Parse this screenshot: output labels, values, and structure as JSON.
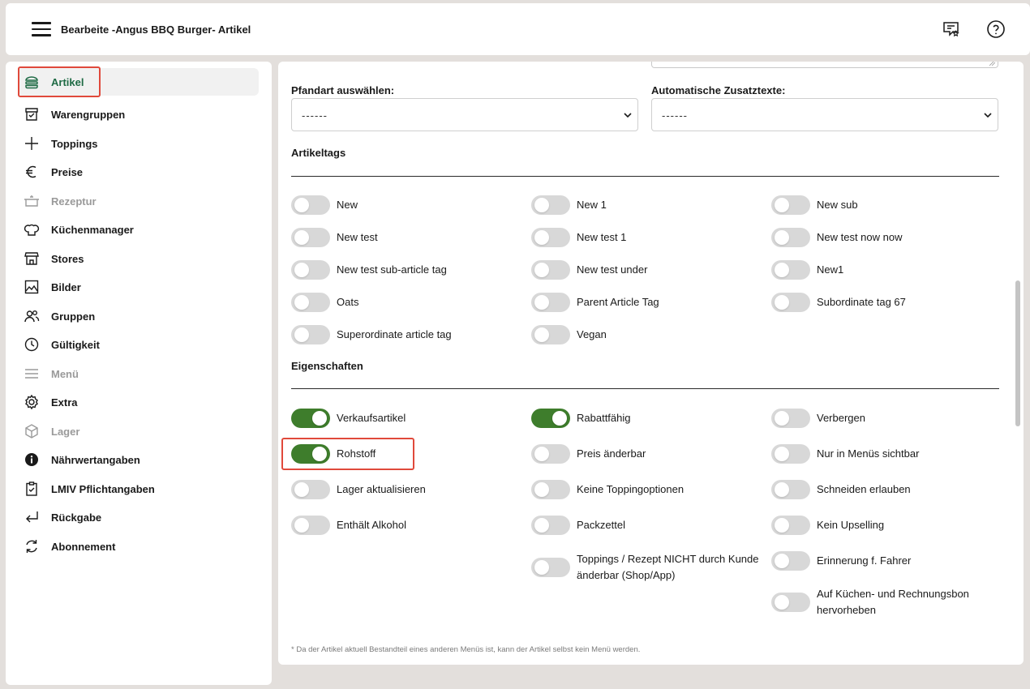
{
  "header": {
    "title": "Bearbeite -Angus BBQ Burger- Artikel"
  },
  "sidebar": {
    "items": [
      {
        "label": "Artikel",
        "icon": "burger-icon",
        "state": "active"
      },
      {
        "label": "Warengruppen",
        "icon": "category-icon",
        "state": "normal"
      },
      {
        "label": "Toppings",
        "icon": "plus-icon",
        "state": "normal"
      },
      {
        "label": "Preise",
        "icon": "euro-icon",
        "state": "normal"
      },
      {
        "label": "Rezeptur",
        "icon": "pot-icon",
        "state": "disabled"
      },
      {
        "label": "Küchenmanager",
        "icon": "chef-hat-icon",
        "state": "normal"
      },
      {
        "label": "Stores",
        "icon": "store-icon",
        "state": "normal"
      },
      {
        "label": "Bilder",
        "icon": "image-icon",
        "state": "normal"
      },
      {
        "label": "Gruppen",
        "icon": "users-icon",
        "state": "normal"
      },
      {
        "label": "Gültigkeit",
        "icon": "clock-icon",
        "state": "normal"
      },
      {
        "label": "Menü",
        "icon": "list-icon",
        "state": "disabled"
      },
      {
        "label": "Extra",
        "icon": "gear-icon",
        "state": "normal"
      },
      {
        "label": "Lager",
        "icon": "box-icon",
        "state": "disabled"
      },
      {
        "label": "Nährwertangaben",
        "icon": "info-icon",
        "state": "normal"
      },
      {
        "label": "LMIV Pflichtangaben",
        "icon": "clipboard-icon",
        "state": "normal"
      },
      {
        "label": "Rückgabe",
        "icon": "return-arrow-icon",
        "state": "normal"
      },
      {
        "label": "Abonnement",
        "icon": "refresh-icon",
        "state": "normal"
      }
    ]
  },
  "form": {
    "pfandart_label": "Pfandart auswählen:",
    "pfandart_value": "------",
    "zusatztexte_label": "Automatische Zusatztexte:",
    "zusatztexte_value": "------"
  },
  "artikeltags": {
    "title": "Artikeltags",
    "tags": [
      {
        "label": "New",
        "on": false
      },
      {
        "label": "New 1",
        "on": false
      },
      {
        "label": "New sub",
        "on": false
      },
      {
        "label": "New test",
        "on": false
      },
      {
        "label": "New test 1",
        "on": false
      },
      {
        "label": "New test now now",
        "on": false
      },
      {
        "label": "New test sub-article tag",
        "on": false
      },
      {
        "label": "New test under",
        "on": false
      },
      {
        "label": "New1",
        "on": false
      },
      {
        "label": "Oats",
        "on": false
      },
      {
        "label": "Parent Article Tag",
        "on": false
      },
      {
        "label": "Subordinate tag 67",
        "on": false
      },
      {
        "label": "Superordinate article tag",
        "on": false
      },
      {
        "label": "Vegan",
        "on": false
      }
    ]
  },
  "eigenschaften": {
    "title": "Eigenschaften",
    "props": [
      {
        "label": "Verkaufsartikel",
        "on": true
      },
      {
        "label": "Rabattfähig",
        "on": true
      },
      {
        "label": "Verbergen",
        "on": false
      },
      {
        "label": "Rohstoff",
        "on": true
      },
      {
        "label": "Preis änderbar",
        "on": false
      },
      {
        "label": "Nur in Menüs sichtbar",
        "on": false
      },
      {
        "label": "Lager aktualisieren",
        "on": false
      },
      {
        "label": "Keine Toppingoptionen",
        "on": false
      },
      {
        "label": "Schneiden erlauben",
        "on": false
      },
      {
        "label": "Enthält Alkohol",
        "on": false
      },
      {
        "label": "Packzettel",
        "on": false
      },
      {
        "label": "Kein Upselling",
        "on": false
      },
      {
        "label": "Toppings / Rezept NICHT durch Kunde änderbar (Shop/App)",
        "on": false
      },
      {
        "label": "Erinnerung f. Fahrer",
        "on": false
      },
      {
        "label": "Auf Küchen- und Rechnungsbon hervorheben",
        "on": false
      }
    ]
  },
  "footnote": "* Da der Artikel aktuell Bestandteil eines anderen Menüs ist, kann der Artikel selbst kein Menü werden.",
  "colors": {
    "accent_green": "#3e7d2c",
    "active_nav_text": "#1f6b45",
    "highlight_red": "#e0493b",
    "toggle_off": "#d8d8d8"
  }
}
